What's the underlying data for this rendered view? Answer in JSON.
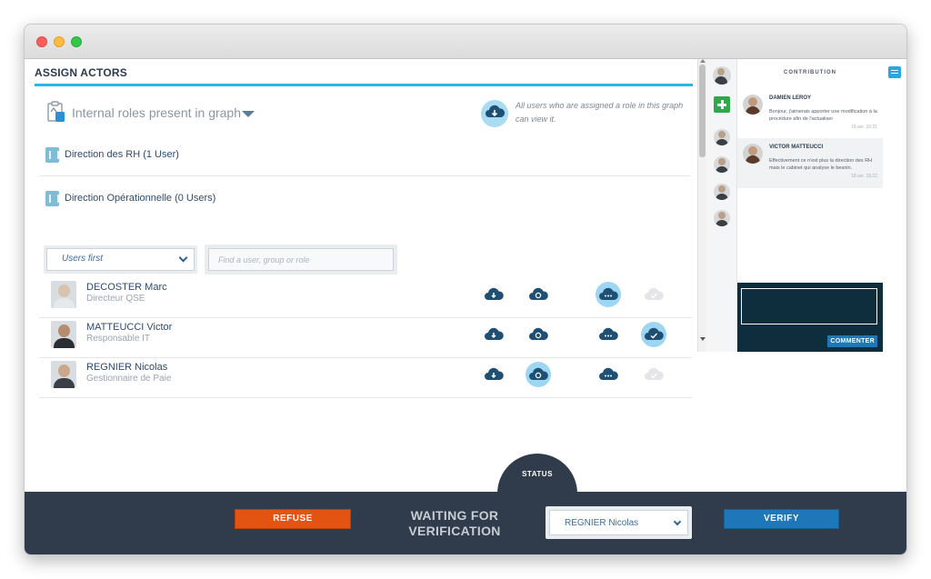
{
  "assign_actors": {
    "title": "ASSIGN ACTORS",
    "roles_dropdown_label": "Internal roles present in graph",
    "info_text": "All users who are assigned a role in this graph can view it.",
    "directions": [
      {
        "label": "Direction des RH (1 User)"
      },
      {
        "label": "Direction Opérationnelle (0 Users)"
      }
    ],
    "sort_select": {
      "value": "Users first"
    },
    "search": {
      "placeholder": "Find a user, group or role",
      "value": ""
    },
    "users": [
      {
        "name": "DECOSTER Marc",
        "role": "Directeur QSE",
        "permissions": {
          "download": true,
          "sync": true,
          "comment": true,
          "validate": false
        },
        "active_permission": "comment"
      },
      {
        "name": "MATTEUCCI Victor",
        "role": "Responsable IT",
        "permissions": {
          "download": true,
          "sync": true,
          "comment": true,
          "validate": true
        },
        "active_permission": "validate"
      },
      {
        "name": "REGNIER Nicolas",
        "role": "Gestionnaire de Paie",
        "permissions": {
          "download": true,
          "sync": true,
          "comment": true,
          "validate": false
        },
        "active_permission": "sync"
      }
    ]
  },
  "contribution": {
    "title": "CONTRIBUTION",
    "messages": [
      {
        "author": "DAMIEN LEROY",
        "text": "Bonjour, j'aimerais apporter une modification à la procédure afin de l'actualiser",
        "time": "18 avr. 15:21"
      },
      {
        "author": "VICTOR MATTEUCCI",
        "text": "Effectivement ce n'est plus la direction des RH mais le cabinet qui analyse le besoin.",
        "time": "18 avr. 15:22"
      }
    ],
    "comment_input_value": "",
    "comment_button": "COMMENTER"
  },
  "status": {
    "tab_label": "STATUS",
    "refuse_label": "REFUSE",
    "state_line1": "WAITING FOR",
    "state_line2": "VERIFICATION",
    "assignee": "REGNIER Nicolas",
    "verify_label": "VERIFY"
  },
  "colors": {
    "accent": "#29b6e8",
    "dark_navy": "#303b4b",
    "refuse": "#e35412",
    "verify": "#1e77b8",
    "icon_blue": "#1f4f72"
  }
}
